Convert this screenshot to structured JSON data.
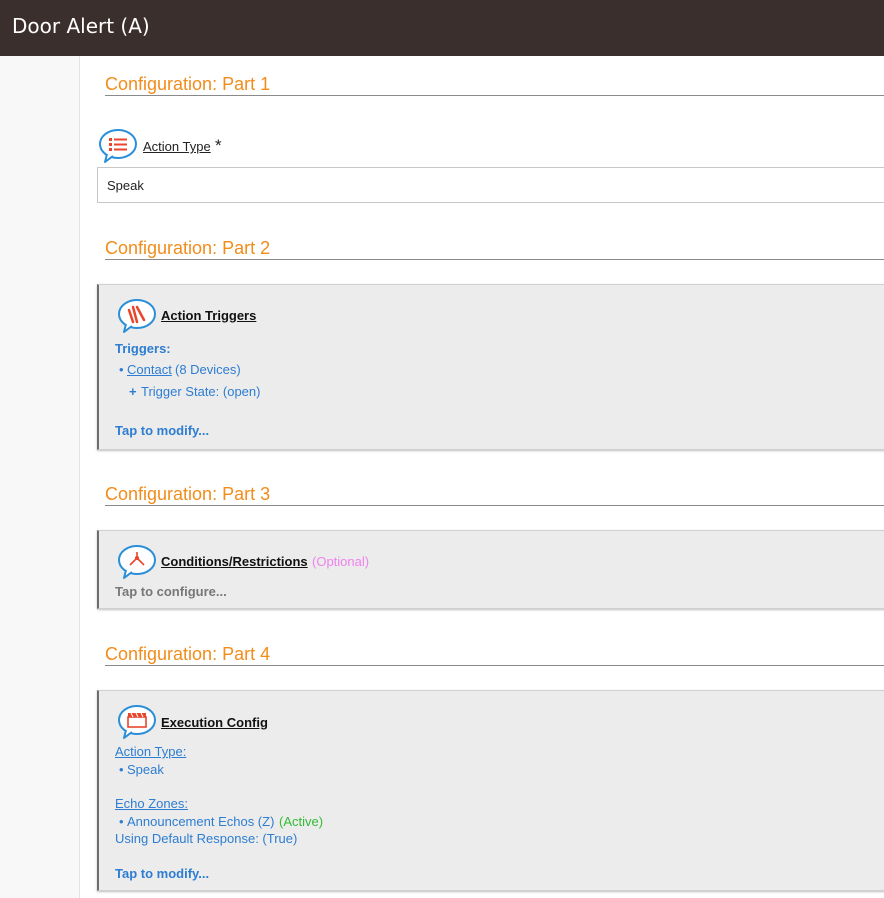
{
  "app": {
    "title": "Door Alert (A)"
  },
  "sections": {
    "part1": "Configuration: Part 1",
    "part2": "Configuration: Part 2",
    "part3": "Configuration: Part 3",
    "part4": "Configuration: Part 4"
  },
  "action_type_field": {
    "label": "Action Type",
    "required_mark": "*",
    "value": "Speak"
  },
  "triggers_card": {
    "title": "Action Triggers",
    "heading": "Triggers:",
    "bullet": "•",
    "device_link": "Contact",
    "device_count": "(8 Devices)",
    "plus": "+",
    "state": "Trigger State: (open)",
    "action": "Tap to modify..."
  },
  "conditions_card": {
    "title": "Conditions/Restrictions",
    "optional": "(Optional)",
    "action": "Tap to configure..."
  },
  "execution_card": {
    "title": "Execution Config",
    "action_type_heading": "Action Type:",
    "bullet": "•",
    "action_type_value": "Speak",
    "echo_zones_heading": "Echo Zones:",
    "echo_zone_name": "Announcement Echos (Z)",
    "echo_zone_status": "(Active)",
    "default_response": "Using Default Response: (True)",
    "action": "Tap to modify..."
  },
  "icons": {
    "action_type": "list-icon",
    "triggers": "lightning-trigger-icon",
    "conditions": "branch-condition-icon",
    "execution": "clapperboard-icon"
  },
  "colors": {
    "titlebar": "#3a2f2c",
    "section_heading": "#f28c1a",
    "link_blue": "#2d7dd2",
    "icon_accent": "#e8452c",
    "bubble_stroke": "#2a8fd8",
    "optional": "#ee82ee",
    "active": "#33bb33"
  }
}
